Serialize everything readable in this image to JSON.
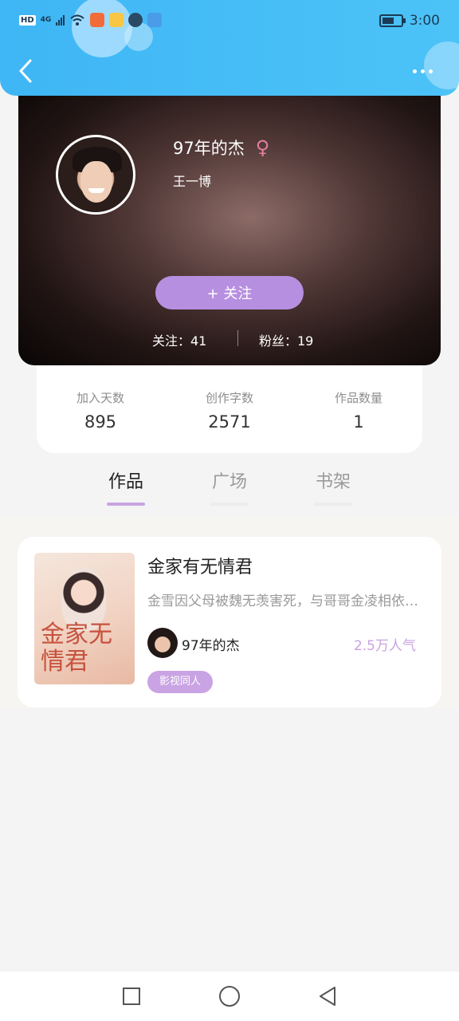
{
  "status_bar": {
    "left": [
      "HD",
      "4G"
    ],
    "time": "3:00"
  },
  "profile": {
    "username": "97年的杰",
    "gender_icon": "♀",
    "subname": "王一博",
    "follow_label": "+ 关注",
    "following": "关注：41",
    "fans": "粉丝：19"
  },
  "stats": [
    {
      "label": "加入天数",
      "value": "895"
    },
    {
      "label": "创作字数",
      "value": "2571"
    },
    {
      "label": "作品数量",
      "value": "1"
    }
  ],
  "tabs": [
    {
      "label": "作品",
      "active": true
    },
    {
      "label": "广场",
      "active": false
    },
    {
      "label": "书架",
      "active": false
    }
  ],
  "works": [
    {
      "title": "金家有无情君",
      "description": "金雪因父母被魏无羡害死，与哥哥金凌相依为命",
      "cover_text": "金家无情君",
      "author": "97年的杰",
      "popularity": "2.5万人气",
      "tag": "影视同人"
    }
  ],
  "colors": {
    "header": "#3fb6f5",
    "accent": "#c9a3e3",
    "follow_button": "#b78fe0",
    "female": "#e27d9e"
  }
}
